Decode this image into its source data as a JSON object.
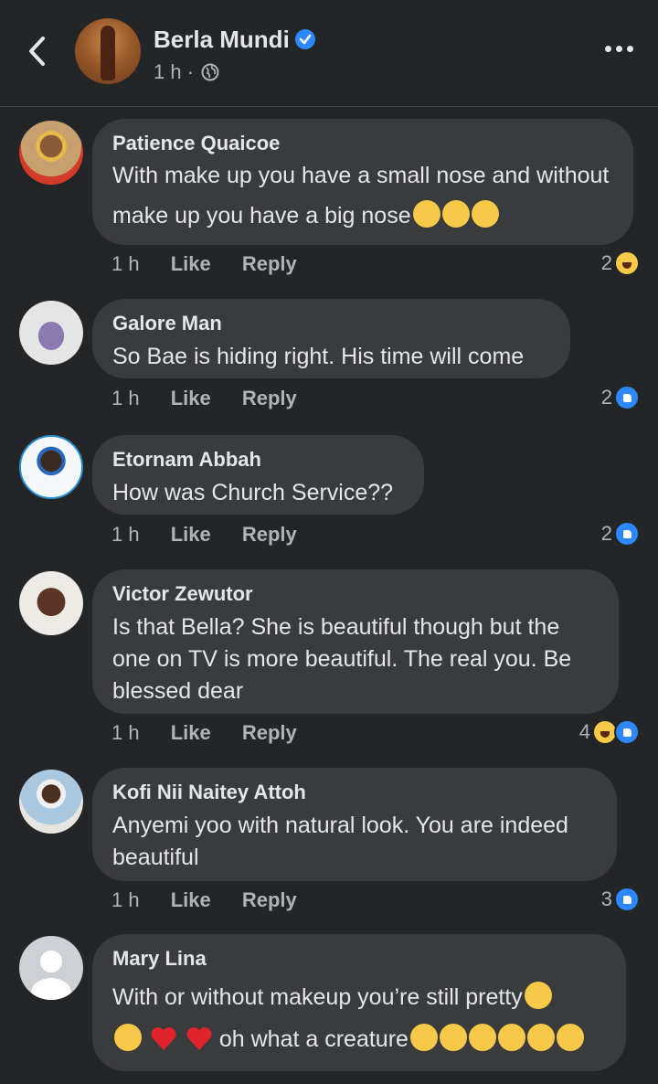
{
  "header": {
    "page_name": "Berla Mundi",
    "meta_time": "1 h ·"
  },
  "comments": [
    {
      "author": "Patience Quaicoe",
      "text": "With make up you have a small nose and without make up you have a big nose",
      "emoji_suffix": [
        "rofl-emoji",
        "rofl-emoji",
        "rofl-emoji"
      ],
      "time": "1 h",
      "like": "Like",
      "reply": "Reply",
      "reaction_count": "2",
      "reactions": [
        "haha"
      ],
      "avatar_color": "#b8874e"
    },
    {
      "author": "Galore Man",
      "text": "So Bae is hiding right. His time will come",
      "time": "1 h",
      "like": "Like",
      "reply": "Reply",
      "reaction_count": "2",
      "reactions": [
        "like"
      ],
      "avatar_color": "#d9d9d9"
    },
    {
      "author": "Etornam Abbah",
      "text": "How was Church Service??",
      "time": "1 h",
      "like": "Like",
      "reply": "Reply",
      "reaction_count": "2",
      "reactions": [
        "like"
      ],
      "avatar_color": "#eaf4f8"
    },
    {
      "author": "Victor Zewutor",
      "text": "Is that Bella? She is beautiful though but the one on TV is more beautiful. The real you. Be blessed dear",
      "time": "1 h",
      "like": "Like",
      "reply": "Reply",
      "reaction_count": "4",
      "reactions": [
        "haha",
        "like"
      ],
      "avatar_color": "#e8e2dc"
    },
    {
      "author": "Kofi Nii Naitey Attoh",
      "text": "Anyemi yoo with natural look. You are indeed beautiful",
      "time": "1 h",
      "like": "Like",
      "reply": "Reply",
      "reaction_count": "3",
      "reactions": [
        "like"
      ],
      "avatar_color": "#e6e6e0"
    },
    {
      "author": "Mary Lina",
      "text_line1": "With or without makeup you’re still pretty",
      "text_line2": "oh what a creature",
      "avatar_color": "#cdd0d4"
    }
  ]
}
